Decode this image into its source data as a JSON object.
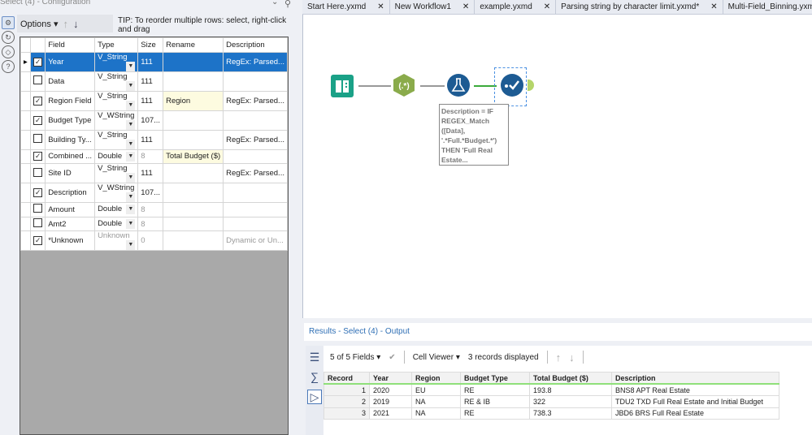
{
  "config_panel": {
    "title": "Select (4) - Configuration",
    "options_label": "Options",
    "tip": "TIP: To reorder multiple rows: select, right-click and drag",
    "columns": [
      "Field",
      "Type",
      "Size",
      "Rename",
      "Description"
    ],
    "rows": [
      {
        "checked": true,
        "field": "Year",
        "type": "V_String",
        "size": "111",
        "rename": "",
        "description": "RegEx: Parsed...",
        "active": true
      },
      {
        "checked": false,
        "field": "Data",
        "type": "V_String",
        "size": "111",
        "rename": "",
        "description": ""
      },
      {
        "checked": true,
        "field": "Region Field",
        "type": "V_String",
        "size": "111",
        "rename": "Region",
        "description": "RegEx: Parsed..."
      },
      {
        "checked": true,
        "field": "Budget Type",
        "type": "V_WString",
        "size": "107...",
        "rename": "",
        "description": ""
      },
      {
        "checked": false,
        "field": "Building Ty...",
        "type": "V_String",
        "size": "111",
        "rename": "",
        "description": "RegEx: Parsed..."
      },
      {
        "checked": true,
        "field": "Combined ...",
        "type": "Double",
        "size": "8",
        "rename": "Total Budget ($)",
        "description": ""
      },
      {
        "checked": false,
        "field": "Site ID",
        "type": "V_String",
        "size": "111",
        "rename": "",
        "description": "RegEx: Parsed..."
      },
      {
        "checked": true,
        "field": "Description",
        "type": "V_WString",
        "size": "107...",
        "rename": "",
        "description": ""
      },
      {
        "checked": false,
        "field": "Amount",
        "type": "Double",
        "size": "8",
        "rename": "",
        "description": ""
      },
      {
        "checked": false,
        "field": "Amt2",
        "type": "Double",
        "size": "8",
        "rename": "",
        "description": ""
      },
      {
        "checked": true,
        "field": "*Unknown",
        "type": "Unknown",
        "size": "0",
        "rename": "",
        "description": "Dynamic or Un..."
      }
    ]
  },
  "tabs": [
    {
      "label": "Start Here.yxmd"
    },
    {
      "label": "New Workflow1"
    },
    {
      "label": "example.yxmd"
    },
    {
      "label": "Parsing string by character limit.yxmd*"
    },
    {
      "label": "Multi-Field_Binning.yxmd"
    }
  ],
  "canvas": {
    "regex_label": "(.*)",
    "annotation": "Description = IF REGEX_Match ([Data], '.*Full.*Budget.*') THEN 'Full Real Estate...",
    "colors": {
      "input": "#1aa187",
      "regex": "#8aab4b",
      "formula": "#1d5b93",
      "select": "#1d5b93",
      "connector": "#b5d56a"
    }
  },
  "results": {
    "title": "Results - Select (4) - Output",
    "fields_label": "5 of 5 Fields",
    "viewer_label": "Cell Viewer",
    "records_label": "3 records displayed",
    "columns": [
      "Record",
      "Year",
      "Region",
      "Budget Type",
      "Total Budget ($)",
      "Description"
    ],
    "rows": [
      [
        "1",
        "2020",
        "EU",
        "RE",
        "193.8",
        "BNS8 APT Real Estate"
      ],
      [
        "2",
        "2019",
        "NA",
        "RE & IB",
        "322",
        "TDU2 TXD Full Real Estate and Initial Budget"
      ],
      [
        "3",
        "2021",
        "NA",
        "RE",
        "738.3",
        "JBD6 BRS Full Real Estate"
      ]
    ]
  }
}
